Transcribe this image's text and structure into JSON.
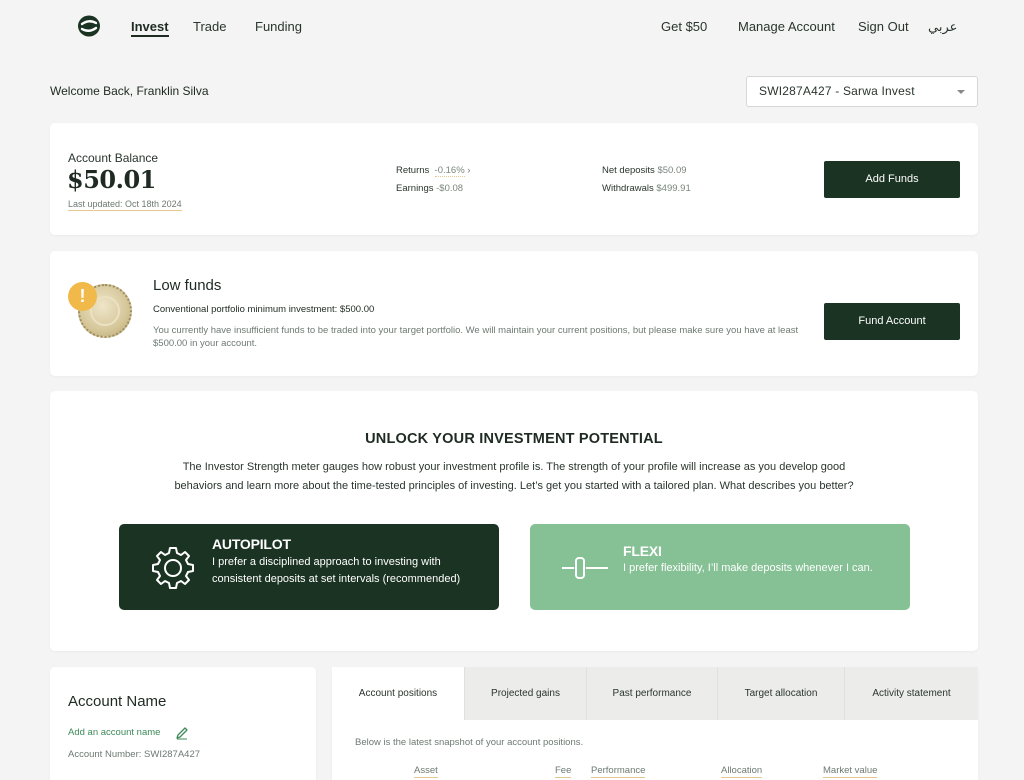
{
  "nav": {
    "links": [
      "Invest",
      "Trade",
      "Funding"
    ],
    "right_links": [
      "Get $50",
      "Manage Account",
      "Sign Out",
      "عربي"
    ]
  },
  "welcome": "Welcome Back, Franklin Silva",
  "account_select": "SWI287A427 - Sarwa Invest",
  "balance": {
    "label": "Account Balance",
    "value": "$50.01",
    "updated": "Last updated: Oct 18th 2024",
    "returns_label": "Returns",
    "returns_value": "-0.16%",
    "earnings_label": "Earnings",
    "earnings_value": "-$0.08",
    "net_deposits_label": "Net deposits",
    "net_deposits_value": "$50.09",
    "withdrawals_label": "Withdrawals",
    "withdrawals_value": "$499.91",
    "add_funds": "Add Funds"
  },
  "low_funds": {
    "title": "Low funds",
    "minimum": "Conventional portfolio minimum investment: $500.00",
    "description": "You currently have insufficient funds to be traded into your target portfolio. We will maintain your current positions, but please make sure you have at least $500.00 in your account.",
    "button": "Fund Account"
  },
  "unlock": {
    "title": "UNLOCK YOUR INVESTMENT POTENTIAL",
    "description": "The Investor Strength meter gauges how robust your investment profile is. The strength of your profile will increase as you develop good behaviors and learn more about the time-tested principles of investing. Let’s get you started with a tailored plan. What describes you better?",
    "autopilot_title": "AUTOPILOT",
    "autopilot_desc": "I prefer a disciplined approach to investing with consistent deposits at set intervals (recommended)",
    "flexi_title": "FLEXI",
    "flexi_desc": "I prefer flexibility, I’ll make deposits whenever I can."
  },
  "account_name": {
    "title": "Account Name",
    "add": "Add an account name",
    "number": "Account Number:  SWI287A427"
  },
  "tabs": [
    "Account positions",
    "Projected gains",
    "Past performance",
    "Target allocation",
    "Activity statement"
  ],
  "positions": {
    "subtitle": "Below is the latest snapshot of your account positions.",
    "columns": [
      "Asset",
      "Fee",
      "Performance",
      "Allocation",
      "Market value"
    ]
  },
  "colors": {
    "brand_dark": "#1b3322",
    "flexi_green": "#85c194",
    "warning": "#f0b94a",
    "link_green": "#3e8a58"
  }
}
